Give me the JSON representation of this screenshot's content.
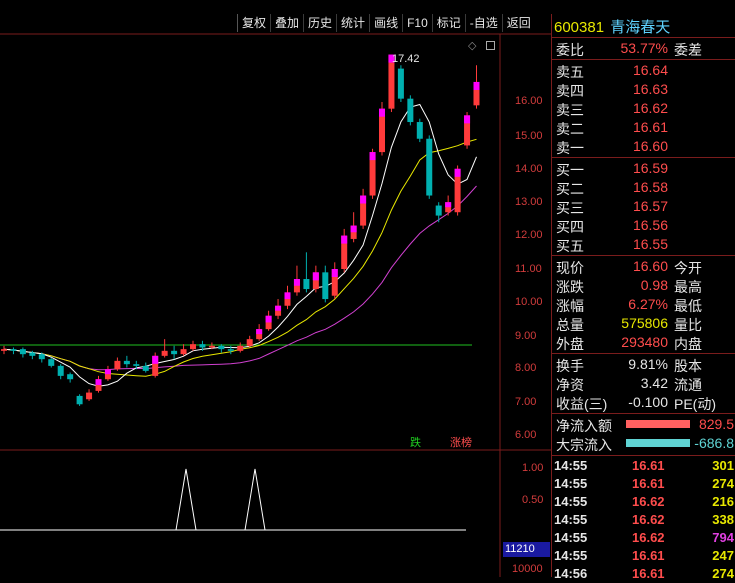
{
  "toolbar": {
    "buttons": [
      "复权",
      "叠加",
      "历史",
      "统计",
      "画线",
      "F10",
      "标记",
      "-自选",
      "返回"
    ]
  },
  "price_axis": [
    "16.00",
    "15.00",
    "14.00",
    "13.00",
    "12.00",
    "11.00",
    "10.00",
    "9.00",
    "8.00",
    "7.00",
    "6.00"
  ],
  "volume_axis": [
    "1.00",
    "0.50",
    "11210",
    "10000"
  ],
  "annotations": {
    "high": "17.42",
    "tag_green": "跌",
    "tag_red": "涨榜"
  },
  "quote": {
    "code": "600381",
    "name": "青海春天",
    "weibi_label": "委比",
    "weibi_value": "53.77%",
    "weicha_label": "委差",
    "asks": [
      {
        "label": "卖五",
        "price": "16.64"
      },
      {
        "label": "卖四",
        "price": "16.63"
      },
      {
        "label": "卖三",
        "price": "16.62"
      },
      {
        "label": "卖二",
        "price": "16.61"
      },
      {
        "label": "卖一",
        "price": "16.60"
      }
    ],
    "bids": [
      {
        "label": "买一",
        "price": "16.59"
      },
      {
        "label": "买二",
        "price": "16.58"
      },
      {
        "label": "买三",
        "price": "16.57"
      },
      {
        "label": "买四",
        "price": "16.56"
      },
      {
        "label": "买五",
        "price": "16.55"
      }
    ],
    "stats": [
      {
        "label": "现价",
        "value": "16.60",
        "label2": "今开"
      },
      {
        "label": "涨跌",
        "value": "0.98",
        "label2": "最高"
      },
      {
        "label": "涨幅",
        "value": "6.27%",
        "label2": "最低"
      },
      {
        "label": "总量",
        "value": "575806",
        "label2": "量比"
      },
      {
        "label": "外盘",
        "value": "293480",
        "label2": "内盘"
      }
    ],
    "stats2": [
      {
        "label": "换手",
        "value": "9.81%",
        "label2": "股本"
      },
      {
        "label": "净资",
        "value": "3.42",
        "label2": "流通"
      },
      {
        "label": "收益(三)",
        "value": "-0.100",
        "label2": "PE(动)"
      }
    ],
    "flow": [
      {
        "label": "净流入额",
        "value": "829.5"
      },
      {
        "label": "大宗流入",
        "value": "-686.8"
      }
    ]
  },
  "ticks": [
    {
      "time": "14:55",
      "price": "16.61",
      "vol": "301"
    },
    {
      "time": "14:55",
      "price": "16.61",
      "vol": "274"
    },
    {
      "time": "14:55",
      "price": "16.62",
      "vol": "216"
    },
    {
      "time": "14:55",
      "price": "16.62",
      "vol": "338"
    },
    {
      "time": "14:55",
      "price": "16.62",
      "vol": "794"
    },
    {
      "time": "14:55",
      "price": "16.61",
      "vol": "247"
    },
    {
      "time": "14:56",
      "price": "16.61",
      "vol": "274"
    }
  ],
  "colors": {
    "up": "#ff3b3b",
    "down": "#00b0b0",
    "ma5": "#ffffff",
    "ma10": "#e8e800",
    "ma20": "#d040d0",
    "base": "#20c020",
    "flowRed": "#ff6060",
    "flowCyan": "#5fd3d3"
  },
  "chart_data": {
    "type": "candlestick",
    "ylim": [
      6.0,
      17.5
    ],
    "candles": [
      {
        "o": 8.55,
        "c": 8.6,
        "h": 8.7,
        "l": 8.45
      },
      {
        "o": 8.6,
        "c": 8.55,
        "h": 8.65,
        "l": 8.45
      },
      {
        "o": 8.6,
        "c": 8.45,
        "h": 8.65,
        "l": 8.35
      },
      {
        "o": 8.5,
        "c": 8.4,
        "h": 8.55,
        "l": 8.3
      },
      {
        "o": 8.45,
        "c": 8.3,
        "h": 8.5,
        "l": 8.2
      },
      {
        "o": 8.3,
        "c": 8.1,
        "h": 8.35,
        "l": 8.05
      },
      {
        "o": 8.1,
        "c": 7.8,
        "h": 8.15,
        "l": 7.7
      },
      {
        "o": 7.85,
        "c": 7.7,
        "h": 7.9,
        "l": 7.6
      },
      {
        "o": 7.2,
        "c": 6.95,
        "h": 7.25,
        "l": 6.9
      },
      {
        "o": 7.1,
        "c": 7.3,
        "h": 7.4,
        "l": 7.05
      },
      {
        "o": 7.35,
        "c": 7.7,
        "h": 7.8,
        "l": 7.3
      },
      {
        "o": 7.7,
        "c": 8.0,
        "h": 8.1,
        "l": 7.65
      },
      {
        "o": 8.0,
        "c": 8.25,
        "h": 8.35,
        "l": 7.95
      },
      {
        "o": 8.25,
        "c": 8.15,
        "h": 8.4,
        "l": 8.05
      },
      {
        "o": 8.15,
        "c": 8.1,
        "h": 8.25,
        "l": 8.0
      },
      {
        "o": 8.1,
        "c": 7.95,
        "h": 8.2,
        "l": 7.9
      },
      {
        "o": 7.8,
        "c": 8.4,
        "h": 8.5,
        "l": 7.75
      },
      {
        "o": 8.4,
        "c": 8.55,
        "h": 8.9,
        "l": 8.35
      },
      {
        "o": 8.55,
        "c": 8.45,
        "h": 8.7,
        "l": 8.3
      },
      {
        "o": 8.45,
        "c": 8.6,
        "h": 8.75,
        "l": 8.4
      },
      {
        "o": 8.6,
        "c": 8.75,
        "h": 8.85,
        "l": 8.55
      },
      {
        "o": 8.75,
        "c": 8.65,
        "h": 8.85,
        "l": 8.55
      },
      {
        "o": 8.65,
        "c": 8.7,
        "h": 8.8,
        "l": 8.6
      },
      {
        "o": 8.7,
        "c": 8.6,
        "h": 8.75,
        "l": 8.5
      },
      {
        "o": 8.6,
        "c": 8.55,
        "h": 8.7,
        "l": 8.45
      },
      {
        "o": 8.55,
        "c": 8.7,
        "h": 8.8,
        "l": 8.5
      },
      {
        "o": 8.7,
        "c": 8.9,
        "h": 9.0,
        "l": 8.65
      },
      {
        "o": 8.9,
        "c": 9.2,
        "h": 9.35,
        "l": 8.85
      },
      {
        "o": 9.2,
        "c": 9.6,
        "h": 9.75,
        "l": 9.15
      },
      {
        "o": 9.6,
        "c": 9.9,
        "h": 10.1,
        "l": 9.5
      },
      {
        "o": 9.9,
        "c": 10.3,
        "h": 10.5,
        "l": 9.8
      },
      {
        "o": 10.3,
        "c": 10.7,
        "h": 11.1,
        "l": 10.2
      },
      {
        "o": 10.7,
        "c": 10.4,
        "h": 11.5,
        "l": 10.3
      },
      {
        "o": 10.4,
        "c": 10.9,
        "h": 11.1,
        "l": 10.3
      },
      {
        "o": 10.9,
        "c": 10.1,
        "h": 11.1,
        "l": 10.0
      },
      {
        "o": 10.2,
        "c": 11.0,
        "h": 11.2,
        "l": 10.1
      },
      {
        "o": 11.0,
        "c": 12.0,
        "h": 12.2,
        "l": 10.9
      },
      {
        "o": 11.9,
        "c": 12.3,
        "h": 12.7,
        "l": 11.8
      },
      {
        "o": 12.3,
        "c": 13.2,
        "h": 13.4,
        "l": 12.2
      },
      {
        "o": 13.2,
        "c": 14.5,
        "h": 14.6,
        "l": 13.1
      },
      {
        "o": 14.5,
        "c": 15.8,
        "h": 16.0,
        "l": 14.4
      },
      {
        "o": 15.8,
        "c": 17.42,
        "h": 17.42,
        "l": 15.7
      },
      {
        "o": 17.0,
        "c": 16.1,
        "h": 17.1,
        "l": 16.0
      },
      {
        "o": 16.1,
        "c": 15.4,
        "h": 16.2,
        "l": 15.3
      },
      {
        "o": 15.4,
        "c": 14.9,
        "h": 15.5,
        "l": 14.8
      },
      {
        "o": 14.9,
        "c": 13.2,
        "h": 15.0,
        "l": 13.1
      },
      {
        "o": 12.9,
        "c": 12.6,
        "h": 13.0,
        "l": 12.4
      },
      {
        "o": 12.7,
        "c": 13.0,
        "h": 13.2,
        "l": 12.6
      },
      {
        "o": 12.7,
        "c": 14.0,
        "h": 14.1,
        "l": 12.6
      },
      {
        "o": 14.7,
        "c": 15.6,
        "h": 15.7,
        "l": 14.6
      },
      {
        "o": 15.9,
        "c": 16.6,
        "h": 17.1,
        "l": 15.8
      }
    ]
  }
}
